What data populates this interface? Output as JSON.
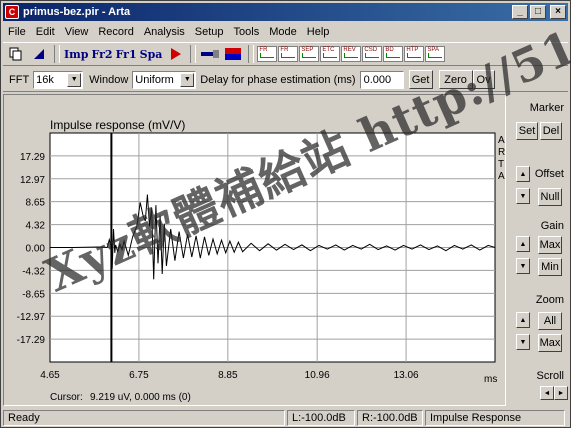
{
  "window": {
    "title": "primus-bez.pir - Arta",
    "app_icon": "C",
    "controls": {
      "minimize": "_",
      "maximize": "□",
      "close": "×"
    }
  },
  "menu": [
    "File",
    "Edit",
    "View",
    "Record",
    "Analysis",
    "Setup",
    "Tools",
    "Mode",
    "Help"
  ],
  "toolbar": {
    "copy_icon": "copy-icon",
    "cursor_icon": "cursor-icon",
    "imp": "Imp",
    "fr2": "Fr2",
    "fr1": "Fr1",
    "spa": "Spa",
    "record_icon": "play-record-icon",
    "mini_graphs": [
      "FR",
      "FR",
      "SEP",
      "ETC",
      "REV",
      "CSD",
      "BD",
      "HTP",
      "SPA"
    ]
  },
  "options": {
    "fft_label": "FFT",
    "fft_value": "16k",
    "window_label": "Window",
    "window_value": "Uniform",
    "delay_label": "Delay for phase estimation (ms)",
    "delay_value": "0.000",
    "get_button": "Get",
    "zero_button": "Zero",
    "ov_button": "Ov"
  },
  "right_panel": {
    "marker_label": "Marker",
    "set_button": "Set",
    "del_button": "Del",
    "offset_label": "Offset",
    "null_button": "Null",
    "gain_label": "Gain",
    "max_button": "Max",
    "min_button": "Min",
    "zoom_label": "Zoom",
    "all_button": "All",
    "zoom_max_button": "Max",
    "scroll_label": "Scroll"
  },
  "plot": {
    "arta_letters": [
      "A",
      "R",
      "T",
      "A"
    ],
    "cursor_label": "Cursor:",
    "cursor_value": "9.219 uV,  0.000 ms  (0)",
    "watermark": "Xyz軟體補給站 http://51.to"
  },
  "chart_data": {
    "type": "line",
    "title": "Impulse response (mV/V)",
    "xlabel": "ms",
    "ylabel": "",
    "x_ticks": [
      "4.65",
      "6.75",
      "8.85",
      "10.96",
      "13.06"
    ],
    "y_ticks": [
      "17.29",
      "12.97",
      "8.65",
      "4.32",
      "0.00",
      "-4.32",
      "-8.65",
      "-12.97",
      "-17.29"
    ],
    "xlim": [
      4.65,
      15.16
    ],
    "ylim": [
      -21.61,
      21.61
    ],
    "grid": true,
    "cursor_x_ms": 6.1,
    "series": [
      {
        "color": "#000000",
        "x": [
          4.65,
          5.2,
          5.8,
          6.0,
          6.05,
          6.1,
          6.12,
          6.15,
          6.18,
          6.2,
          6.25,
          6.3,
          6.35,
          6.4,
          6.5,
          6.6,
          6.7,
          6.78,
          6.85,
          6.9,
          6.95,
          7.0,
          7.05,
          7.1,
          7.15,
          7.2,
          7.25,
          7.3,
          7.35,
          7.4,
          7.5,
          7.6,
          7.7,
          7.8,
          7.9,
          8.0,
          8.1,
          8.2,
          8.3,
          8.4,
          8.5,
          8.6,
          8.7,
          8.8,
          8.9,
          9.0,
          9.1,
          9.2,
          9.4,
          9.6,
          9.8,
          10.0,
          10.2,
          10.4,
          10.6,
          10.8,
          11.0,
          11.2,
          11.4,
          11.6,
          11.8,
          12.0,
          12.2,
          12.4,
          12.6,
          12.8,
          13.0,
          13.2,
          13.4,
          13.6,
          13.8,
          14.0,
          14.2,
          14.4,
          14.6,
          14.8,
          15.0,
          15.16
        ],
        "y": [
          0.0,
          0.0,
          0.1,
          0.0,
          1.5,
          0.0,
          -4.0,
          3.5,
          -1.0,
          0.5,
          -0.8,
          0.6,
          -0.4,
          1.2,
          -1.5,
          2.0,
          4.0,
          8.5,
          6.0,
          5.0,
          10.0,
          4.0,
          7.5,
          -6.0,
          8.0,
          -3.0,
          6.0,
          -5.0,
          4.5,
          -3.5,
          3.5,
          -2.5,
          3.0,
          -2.0,
          2.5,
          -1.8,
          2.2,
          -2.0,
          2.0,
          -1.5,
          1.6,
          -1.2,
          1.4,
          -1.0,
          1.2,
          -0.9,
          1.0,
          -0.8,
          0.8,
          -0.6,
          0.7,
          -0.5,
          0.6,
          -0.4,
          0.5,
          -0.6,
          0.4,
          -0.3,
          0.5,
          -0.5,
          0.4,
          -0.3,
          0.6,
          -0.4,
          0.3,
          -0.5,
          0.4,
          -0.3,
          0.5,
          -0.4,
          0.3,
          -0.6,
          0.4,
          -0.3,
          0.5,
          -0.5,
          0.4,
          0.0
        ]
      }
    ]
  },
  "status": {
    "ready": "Ready",
    "left": "L:-100.0dB",
    "right": "R:-100.0dB",
    "mode": "Impulse Response"
  }
}
